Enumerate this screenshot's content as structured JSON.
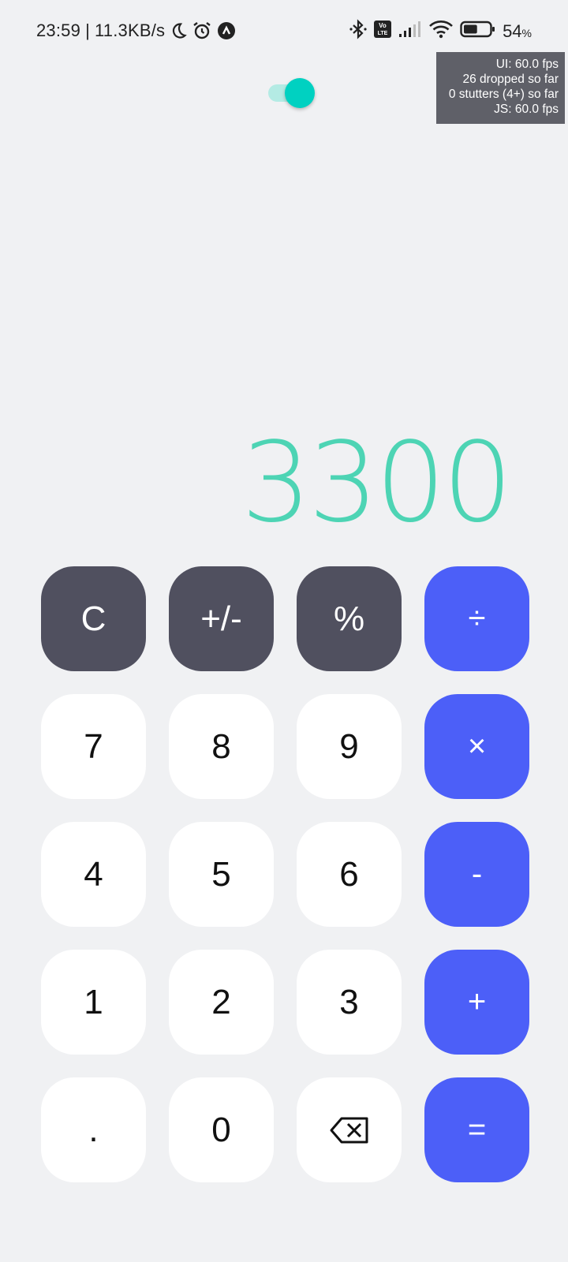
{
  "status_bar": {
    "time": "23:59",
    "separator": "|",
    "net_speed": "11.3KB/s",
    "left_icons": [
      "moon-icon",
      "alarm-icon",
      "app-notification-icon"
    ],
    "right_icons": [
      "bluetooth-icon",
      "volte-icon",
      "signal-icon",
      "wifi-icon",
      "battery-icon"
    ],
    "volte_label": "Vo\nLTE",
    "battery_level": 54,
    "battery_value": "54",
    "battery_unit": "%"
  },
  "fps_overlay": {
    "lines": [
      "UI: 60.0 fps",
      "26 dropped so far",
      "0 stutters (4+) so far",
      "JS: 60.0 fps"
    ]
  },
  "theme_toggle": {
    "state": "on",
    "color": "#00d1c1"
  },
  "display": {
    "value": "3300",
    "color": "#4dd4b4"
  },
  "keypad": {
    "rows": [
      [
        {
          "label": "C",
          "type": "fn",
          "name": "clear"
        },
        {
          "label": "+/-",
          "type": "fn",
          "name": "sign"
        },
        {
          "label": "%",
          "type": "fn",
          "name": "percent"
        },
        {
          "label": "÷",
          "type": "op",
          "name": "divide"
        }
      ],
      [
        {
          "label": "7",
          "type": "num",
          "name": "7"
        },
        {
          "label": "8",
          "type": "num",
          "name": "8"
        },
        {
          "label": "9",
          "type": "num",
          "name": "9"
        },
        {
          "label": "×",
          "type": "op",
          "name": "multiply"
        }
      ],
      [
        {
          "label": "4",
          "type": "num",
          "name": "4"
        },
        {
          "label": "5",
          "type": "num",
          "name": "5"
        },
        {
          "label": "6",
          "type": "num",
          "name": "6"
        },
        {
          "label": "-",
          "type": "op",
          "name": "subtract"
        }
      ],
      [
        {
          "label": "1",
          "type": "num",
          "name": "1"
        },
        {
          "label": "2",
          "type": "num",
          "name": "2"
        },
        {
          "label": "3",
          "type": "num",
          "name": "3"
        },
        {
          "label": "+",
          "type": "op",
          "name": "add"
        }
      ],
      [
        {
          "label": ".",
          "type": "num",
          "name": "decimal"
        },
        {
          "label": "0",
          "type": "num",
          "name": "0"
        },
        {
          "label": "",
          "type": "num",
          "name": "backspace",
          "icon": "backspace-icon"
        },
        {
          "label": "=",
          "type": "op",
          "name": "equals"
        }
      ]
    ],
    "colors": {
      "fn": "#50505f",
      "op": "#4c5ff8",
      "num": "#ffffff"
    }
  }
}
